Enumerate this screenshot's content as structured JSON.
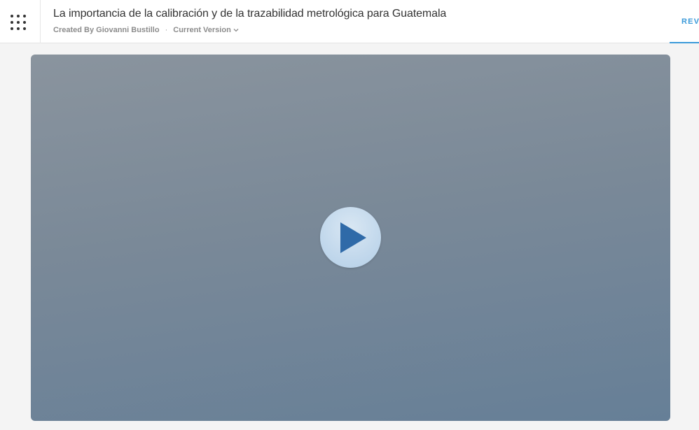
{
  "header": {
    "title": "La importancia de la calibración y de la trazabilidad metrológica para Guatemala",
    "created_by": "Created By Giovanni Bustillo",
    "separator": "·",
    "version_label": "Current Version",
    "review_tab_label": "REVIEW"
  },
  "icons": {
    "menu": "grid-dots-icon",
    "version_chevron": "chevron-down-icon",
    "play": "play-icon"
  },
  "colors": {
    "accent": "#3b9ad9",
    "play_triangle": "#2f6aa8",
    "player_top": "#8a949e",
    "player_bottom": "#667f97"
  }
}
